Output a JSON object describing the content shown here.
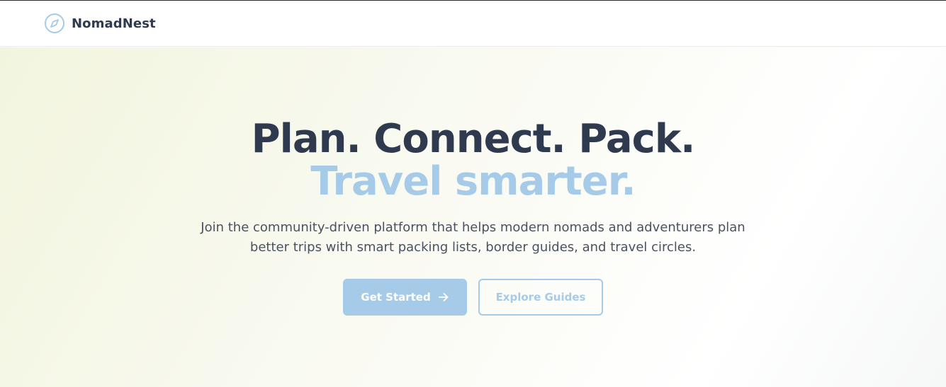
{
  "brand": {
    "name": "NomadNest",
    "icon": "compass-icon",
    "icon_color": "#a5cbe8"
  },
  "hero": {
    "headline_line1": "Plan. Connect. Pack.",
    "headline_line2": "Travel smarter.",
    "subtitle": "Join the community-driven platform that helps modern nomads and adventurers plan better trips with smart packing lists, border guides, and travel circles.",
    "primary_cta": {
      "label": "Get Started",
      "icon": "arrow-right-icon"
    },
    "secondary_cta": {
      "label": "Explore Guides"
    }
  },
  "colors": {
    "text_dark": "#2f3a4f",
    "accent": "#a5cbe8",
    "body_text": "#4a5160"
  }
}
